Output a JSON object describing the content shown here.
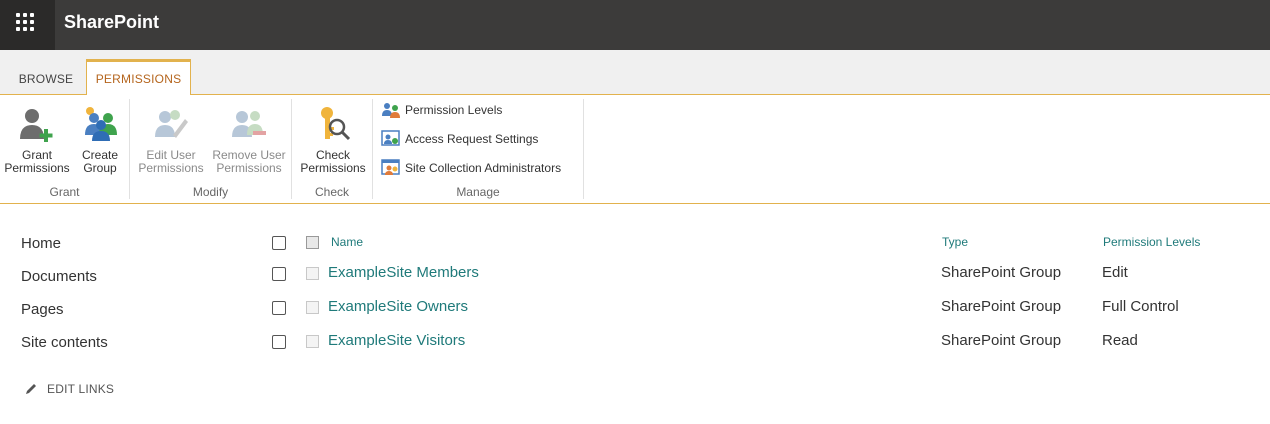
{
  "app": {
    "title": "SharePoint"
  },
  "icons": {
    "waffle": "app-launcher-icon"
  },
  "ribbon": {
    "tabs": [
      {
        "label": "BROWSE",
        "selected": false
      },
      {
        "label": "PERMISSIONS",
        "selected": true
      }
    ],
    "groups": {
      "grant": {
        "label": "Grant",
        "buttons": [
          {
            "label": "Grant\nPermissions",
            "icon": "grant-permissions-icon",
            "enabled": true
          },
          {
            "label": "Create\nGroup",
            "icon": "create-group-icon",
            "enabled": true
          }
        ]
      },
      "modify": {
        "label": "Modify",
        "buttons": [
          {
            "label": "Edit User\nPermissions",
            "icon": "edit-user-permissions-icon",
            "enabled": false
          },
          {
            "label": "Remove User\nPermissions",
            "icon": "remove-user-permissions-icon",
            "enabled": false
          }
        ]
      },
      "check": {
        "label": "Check",
        "buttons": [
          {
            "label": "Check\nPermissions",
            "icon": "check-permissions-icon",
            "enabled": true
          }
        ]
      },
      "manage": {
        "label": "Manage",
        "buttons": [
          {
            "label": "Permission Levels",
            "icon": "permission-levels-icon"
          },
          {
            "label": "Access Request Settings",
            "icon": "access-request-settings-icon"
          },
          {
            "label": "Site Collection Administrators",
            "icon": "site-collection-administrators-icon"
          }
        ]
      }
    }
  },
  "leftnav": {
    "items": [
      "Home",
      "Documents",
      "Pages",
      "Site contents"
    ],
    "edit_links": "EDIT LINKS"
  },
  "table": {
    "headers": {
      "name": "Name",
      "type": "Type",
      "levels": "Permission Levels"
    },
    "rows": [
      {
        "name": "ExampleSite Members",
        "type": "SharePoint Group",
        "level": "Edit"
      },
      {
        "name": "ExampleSite Owners",
        "type": "SharePoint Group",
        "level": "Full Control"
      },
      {
        "name": "ExampleSite Visitors",
        "type": "SharePoint Group",
        "level": "Read"
      }
    ]
  },
  "colors": {
    "suitebar": "#3c3b3a",
    "accent": "#e2b24d",
    "link": "#1f7a7a"
  }
}
